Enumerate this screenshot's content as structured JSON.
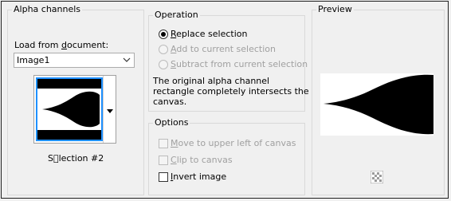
{
  "alpha": {
    "title": "Alpha channels",
    "load_label_pre": "Load from ",
    "load_label_u": "d",
    "load_label_post": "ocument:",
    "selected_document": "Image1",
    "selection_name": "S\u0000lection #2"
  },
  "operation": {
    "title": "Operation",
    "options": [
      {
        "u": "R",
        "rest": "eplace selection",
        "checked": true,
        "enabled": true
      },
      {
        "u": "A",
        "rest": "dd to current selection",
        "checked": false,
        "enabled": false
      },
      {
        "u": "S",
        "rest": "ubtract from current selection",
        "checked": false,
        "enabled": false
      }
    ],
    "message": [
      "The original alpha channel",
      "rectangle completely intersects the",
      "canvas."
    ]
  },
  "options": {
    "title": "Options",
    "items": [
      {
        "u": "M",
        "rest": "ove to upper left of canvas",
        "checked": false,
        "enabled": false
      },
      {
        "u": "C",
        "rest": "lip to canvas",
        "checked": false,
        "enabled": false
      },
      {
        "u": "I",
        "rest": "nvert image",
        "checked": false,
        "enabled": true
      }
    ]
  },
  "preview": {
    "title": "Preview"
  },
  "icons": {
    "dropdown": "chevron-down-icon",
    "thumb_dropdown": "triangle-down-icon",
    "transparency": "checkerboard-icon"
  }
}
